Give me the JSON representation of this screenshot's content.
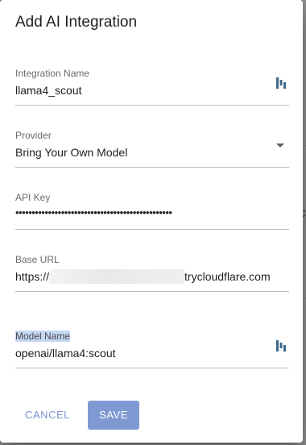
{
  "dialog": {
    "title": "Add AI Integration",
    "fields": {
      "integration_name": {
        "label": "Integration Name",
        "value": "llama4_scout",
        "icon": "password-manager-icon"
      },
      "provider": {
        "label": "Provider",
        "value": "Bring Your Own Model",
        "icon": "dropdown-arrow-icon"
      },
      "api_key": {
        "label": "API Key",
        "value": "••••••••••••••••••••••••••••••••••••••••••••••••"
      },
      "base_url": {
        "label": "Base URL",
        "value_prefix": "https://",
        "value_suffix": "trycloudflare.com"
      },
      "model_name": {
        "label": "Model Name",
        "value": "openai/llama4:scout",
        "icon": "password-manager-icon"
      }
    },
    "buttons": {
      "cancel": "CANCEL",
      "save": "SAVE"
    }
  },
  "colors": {
    "accent": "#7f9ad3",
    "label_highlight": "#c5d7f3"
  }
}
